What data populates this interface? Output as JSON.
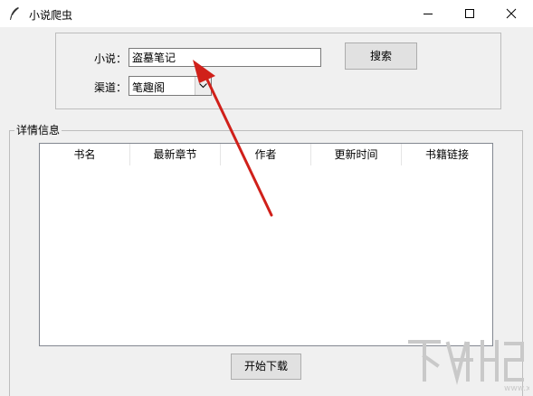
{
  "window": {
    "title": "小说爬虫",
    "icon": "feather-icon"
  },
  "controls": {
    "minimize_icon": "minimize-icon",
    "maximize_icon": "maximize-icon",
    "close_icon": "close-icon"
  },
  "search": {
    "novel_label": "小说：",
    "novel_value": "盗墓笔记",
    "channel_label": "渠道：",
    "channel_value": "笔趣阁",
    "search_button": "搜索"
  },
  "details": {
    "legend": "详情信息",
    "columns": [
      "书名",
      "最新章节",
      "作者",
      "更新时间",
      "书籍链接"
    ],
    "rows": []
  },
  "actions": {
    "download_button": "开始下载"
  },
  "annotation": {
    "arrow_color": "#d0201a"
  }
}
